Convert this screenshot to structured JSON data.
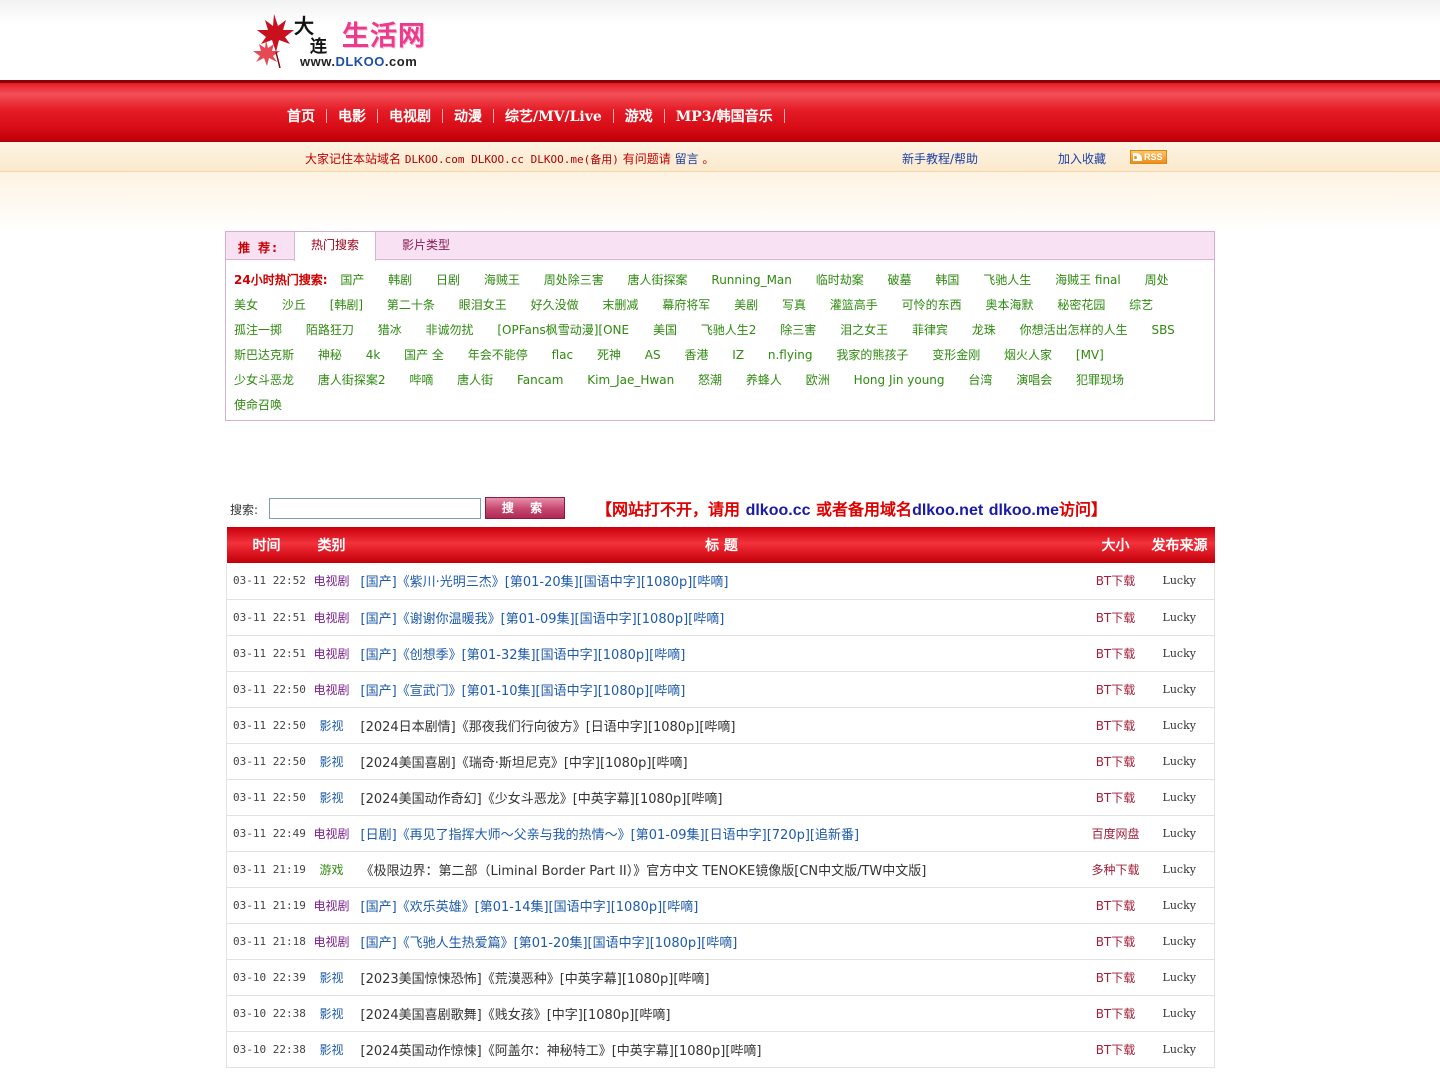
{
  "logo": {
    "char_da": "大",
    "char_lian": "连",
    "site_name": "生活网",
    "url_prefix": "www.",
    "url_brand": "DLKOO",
    "url_suffix": ".com"
  },
  "nav": {
    "items": [
      "首页",
      "电影",
      "电视剧",
      "动漫",
      "综艺/MV/Live",
      "游戏",
      "MP3/韩国音乐"
    ]
  },
  "notice": {
    "prefix": "大家记住本站域名",
    "domains": "DLKOO.com DLKOO.cc DLKOO.me(备用)",
    "middle": "有问题请",
    "link": "留言",
    "suffix": "。",
    "help": "新手教程/帮助",
    "favorite": "加入收藏",
    "rss": "RSS"
  },
  "hot": {
    "title": "推 荐:",
    "tab_active": "热门搜索",
    "tab_other": "影片类型",
    "label": "24小时热门搜索:",
    "keywords": [
      "国产",
      "韩剧",
      "日剧",
      "海贼王",
      "周处除三害",
      "唐人街探案",
      "Running_Man",
      "临时劫案",
      "破墓",
      "韩国",
      "飞驰人生",
      "海贼王 final",
      "周处",
      "美女",
      "沙丘",
      "[韩剧]",
      "第二十条",
      "眼泪女王",
      "好久没做",
      "末删减",
      "幕府将军",
      "美剧",
      "写真",
      "灌篮高手",
      "可怜的东西",
      "奥本海默",
      "秘密花园",
      "综艺",
      "孤注一掷",
      "陌路狂刀",
      "猎冰",
      "非诚勿扰",
      "[OPFans枫雪动漫][ONE",
      "美国",
      "飞驰人生2",
      "除三害",
      "泪之女王",
      "菲律宾",
      "龙珠",
      "你想活出怎样的人生",
      "SBS",
      "斯巴达克斯",
      "神秘",
      "4k",
      "国产 全",
      "年会不能停",
      "flac",
      "死神",
      "AS",
      "香港",
      "IZ",
      "n.flying",
      "我家的熊孩子",
      "变形金刚",
      "烟火人家",
      "[MV]",
      "少女斗恶龙",
      "唐人街探案2",
      "哔嘀",
      "唐人街",
      "Fancam",
      "Kim_Jae_Hwan",
      "怒潮",
      "养蜂人",
      "欧洲",
      "Hong Jin young",
      "台湾",
      "演唱会",
      "犯罪现场",
      "使命召唤"
    ]
  },
  "search": {
    "label": "搜索:",
    "placeholder": "",
    "button": "搜 索"
  },
  "domain_note": {
    "part1": "【网站打不开，请用 ",
    "domain1": "dlkoo.cc",
    "part2": " 或者备用域名",
    "domain2": "dlkoo.net",
    "part3": " ",
    "domain3": "dlkoo.me",
    "part4": "访问】"
  },
  "table": {
    "headers": [
      "时间",
      "类别",
      "标 题",
      "大小",
      "发布来源"
    ],
    "rows": [
      {
        "time": "03-11 22:52",
        "type": "电视剧",
        "title": "[国产]《紫川·光明三杰》[第01-20集][国语中字][1080p][哔嘀]",
        "size": "BT下载",
        "src": "Lucky"
      },
      {
        "time": "03-11 22:51",
        "type": "电视剧",
        "title": "[国产]《谢谢你温暖我》[第01-09集][国语中字][1080p][哔嘀]",
        "size": "BT下载",
        "src": "Lucky"
      },
      {
        "time": "03-11 22:51",
        "type": "电视剧",
        "title": "[国产]《创想季》[第01-32集][国语中字][1080p][哔嘀]",
        "size": "BT下载",
        "src": "Lucky"
      },
      {
        "time": "03-11 22:50",
        "type": "电视剧",
        "title": "[国产]《宣武门》[第01-10集][国语中字][1080p][哔嘀]",
        "size": "BT下载",
        "src": "Lucky"
      },
      {
        "time": "03-11 22:50",
        "type": "影视",
        "title": "[2024日本剧情]《那夜我们行向彼方》[日语中字][1080p][哔嘀]",
        "size": "BT下载",
        "src": "Lucky"
      },
      {
        "time": "03-11 22:50",
        "type": "影视",
        "title": "[2024美国喜剧]《瑞奇·斯坦尼克》[中字][1080p][哔嘀]",
        "size": "BT下载",
        "src": "Lucky"
      },
      {
        "time": "03-11 22:50",
        "type": "影视",
        "title": "[2024美国动作奇幻]《少女斗恶龙》[中英字幕][1080p][哔嘀]",
        "size": "BT下载",
        "src": "Lucky"
      },
      {
        "time": "03-11 22:49",
        "type": "电视剧",
        "title": "[日剧]《再见了指挥大师～父亲与我的热情～》[第01-09集][日语中字][720p][追新番]",
        "size": "百度网盘",
        "src": "Lucky"
      },
      {
        "time": "03-11 21:19",
        "type": "游戏",
        "title": "《极限边界：第二部（Liminal Border Part II）》官方中文 TENOKE镜像版[CN中文版/TW中文版]",
        "size": "多种下载",
        "src": "Lucky"
      },
      {
        "time": "03-11 21:19",
        "type": "电视剧",
        "title": "[国产]《欢乐英雄》[第01-14集][国语中字][1080p][哔嘀]",
        "size": "BT下载",
        "src": "Lucky"
      },
      {
        "time": "03-11 21:18",
        "type": "电视剧",
        "title": "[国产]《飞驰人生热爱篇》[第01-20集][国语中字][1080p][哔嘀]",
        "size": "BT下载",
        "src": "Lucky"
      },
      {
        "time": "03-10 22:39",
        "type": "影视",
        "title": "[2023美国惊悚恐怖]《荒漠恶种》[中英字幕][1080p][哔嘀]",
        "size": "BT下载",
        "src": "Lucky"
      },
      {
        "time": "03-10 22:38",
        "type": "影视",
        "title": "[2024美国喜剧歌舞]《贱女孩》[中字][1080p][哔嘀]",
        "size": "BT下载",
        "src": "Lucky"
      },
      {
        "time": "03-10 22:38",
        "type": "影视",
        "title": "[2024英国动作惊悚]《阿盖尔：神秘特工》[中英字幕][1080p][哔嘀]",
        "size": "BT下载",
        "src": "Lucky"
      }
    ]
  }
}
